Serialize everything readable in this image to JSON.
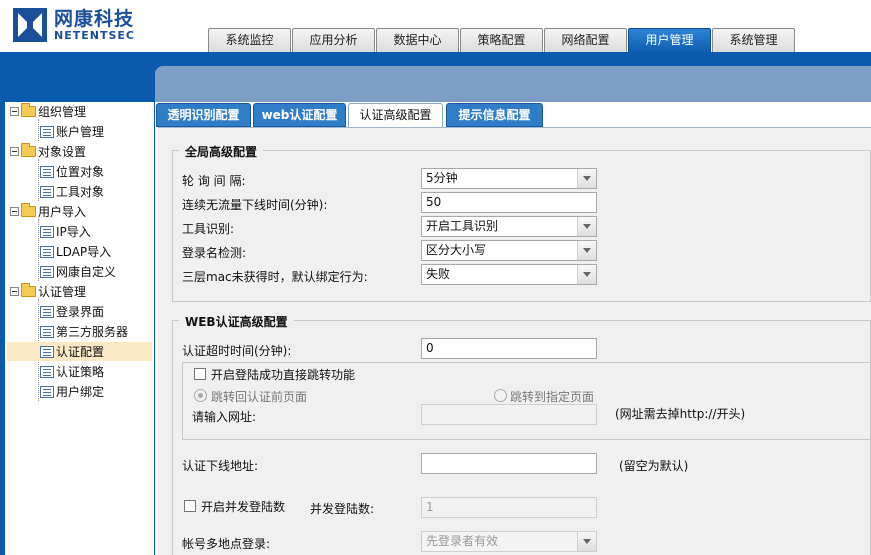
{
  "brand": {
    "name_cn": "网康科技",
    "name_en": "NETENTSEC",
    "color": "#1a4f9c"
  },
  "top_nav": {
    "tabs": [
      {
        "label": "系统监控"
      },
      {
        "label": "应用分析"
      },
      {
        "label": "数据中心"
      },
      {
        "label": "策略配置"
      },
      {
        "label": "网络配置"
      },
      {
        "label": "用户管理",
        "active": true
      },
      {
        "label": "系统管理"
      }
    ],
    "active_color": "#0d5eb1"
  },
  "sidebar": {
    "items": [
      {
        "label": "组织管理",
        "type": "folder"
      },
      {
        "label": "账户管理",
        "type": "leaf"
      },
      {
        "label": "对象设置",
        "type": "folder"
      },
      {
        "label": "位置对象",
        "type": "leaf"
      },
      {
        "label": "工具对象",
        "type": "leaf"
      },
      {
        "label": "用户导入",
        "type": "folder"
      },
      {
        "label": "IP导入",
        "type": "leaf"
      },
      {
        "label": "LDAP导入",
        "type": "leaf"
      },
      {
        "label": "网康自定义",
        "type": "leaf"
      },
      {
        "label": "认证管理",
        "type": "folder"
      },
      {
        "label": "登录界面",
        "type": "leaf"
      },
      {
        "label": "第三方服务器",
        "type": "leaf"
      },
      {
        "label": "认证配置",
        "type": "leaf",
        "selected": true
      },
      {
        "label": "认证策略",
        "type": "leaf"
      },
      {
        "label": "用户绑定",
        "type": "leaf"
      }
    ]
  },
  "sub_tabs": [
    {
      "label": "透明识别配置"
    },
    {
      "label": "web认证配置"
    },
    {
      "label": "认证高级配置",
      "active": true
    },
    {
      "label": "提示信息配置"
    }
  ],
  "global_section": {
    "title": "全局高级配置",
    "fields": {
      "poll_interval": {
        "label": "轮 询 间 隔:",
        "value": "5分钟"
      },
      "idle_timeout": {
        "label": "连续无流量下线时间(分钟):",
        "value": "50"
      },
      "tool_detect": {
        "label": "工具识别:",
        "value": "开启工具识别"
      },
      "login_check": {
        "label": "登录名检测:",
        "value": "区分大小写"
      },
      "mac_fail": {
        "label": "三层mac未获得时，默认绑定行为:",
        "value": "失败"
      }
    }
  },
  "web_section": {
    "title": "WEB认证高级配置",
    "auth_timeout": {
      "label": "认证超时时间(分钟):",
      "value": "0"
    },
    "redirect_enable": {
      "label": "开启登陆成功直接跳转功能",
      "checked": false
    },
    "redirect_back": {
      "label": "跳转回认证前页面",
      "checked": true
    },
    "redirect_custom": {
      "label": "跳转到指定页面",
      "checked": false
    },
    "url": {
      "label": "请输入网址:",
      "value": "",
      "hint": "(网址需去掉http://开头)"
    },
    "logout_url": {
      "label": "认证下线地址:",
      "value": "",
      "hint": "(留空为默认)"
    },
    "concurrent_enable": {
      "label": "开启并发登陆数",
      "checked": false
    },
    "concurrent_count": {
      "label": "并发登陆数:",
      "value": "1"
    },
    "multi_login": {
      "label": "帐号多地点登录:",
      "value": "先登录者有效"
    }
  }
}
